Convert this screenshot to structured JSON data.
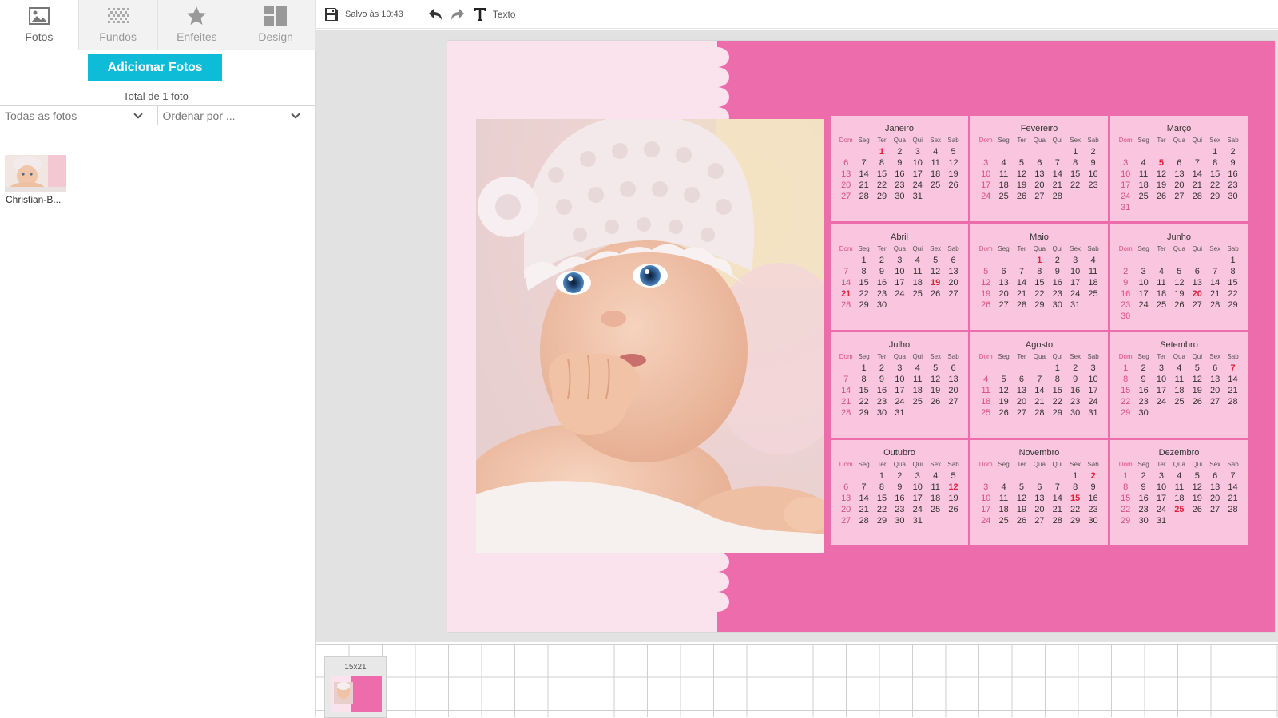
{
  "tabs": [
    {
      "label": "Fotos",
      "icon": "image-icon",
      "active": true
    },
    {
      "label": "Fundos",
      "icon": "pattern-icon",
      "active": false
    },
    {
      "label": "Enfeites",
      "icon": "star-icon",
      "active": false
    },
    {
      "label": "Design",
      "icon": "layout-icon",
      "active": false
    }
  ],
  "photos_panel": {
    "add_button": "Adicionar Fotos",
    "total": "Total de 1 foto",
    "filter_all": "Todas as fotos",
    "sort_by": "Ordenar por ...",
    "photos": [
      {
        "name": "Christian-B..."
      }
    ]
  },
  "toolbar": {
    "save_icon": "save-icon",
    "saved_text": "Salvo às 10:43",
    "undo_icon": "undo-icon",
    "redo_icon": "redo-icon",
    "text_icon": "text-icon",
    "text_label": "Texto"
  },
  "colors": {
    "accent": "#0fbcd7",
    "canvas_pink": "#ed6cab",
    "light_panel": "#fbe3ee",
    "month_bg": "#f9c5df",
    "sunday": "#d9507f",
    "holiday": "#e0203a"
  },
  "calendar": {
    "weekdays": [
      "Dom",
      "Seg",
      "Ter",
      "Qua",
      "Qui",
      "Sex",
      "Sab"
    ],
    "months": [
      {
        "name": "Janeiro",
        "start": 2,
        "days": 31,
        "holidays": [
          1
        ]
      },
      {
        "name": "Fevereiro",
        "start": 5,
        "days": 28,
        "holidays": []
      },
      {
        "name": "Março",
        "start": 5,
        "days": 31,
        "holidays": [
          5
        ]
      },
      {
        "name": "Abril",
        "start": 1,
        "days": 30,
        "holidays": [
          19,
          21
        ]
      },
      {
        "name": "Maio",
        "start": 3,
        "days": 31,
        "holidays": [
          1
        ]
      },
      {
        "name": "Junho",
        "start": 6,
        "days": 30,
        "holidays": [
          20
        ]
      },
      {
        "name": "Julho",
        "start": 1,
        "days": 31,
        "holidays": []
      },
      {
        "name": "Agosto",
        "start": 4,
        "days": 31,
        "holidays": []
      },
      {
        "name": "Setembro",
        "start": 0,
        "days": 30,
        "holidays": [
          7
        ]
      },
      {
        "name": "Outubro",
        "start": 2,
        "days": 31,
        "holidays": [
          12
        ]
      },
      {
        "name": "Novembro",
        "start": 5,
        "days": 30,
        "holidays": [
          2,
          15
        ]
      },
      {
        "name": "Dezembro",
        "start": 0,
        "days": 31,
        "holidays": [
          25
        ]
      }
    ]
  },
  "page_strip": {
    "pages": [
      {
        "size_label": "15x21"
      }
    ]
  }
}
